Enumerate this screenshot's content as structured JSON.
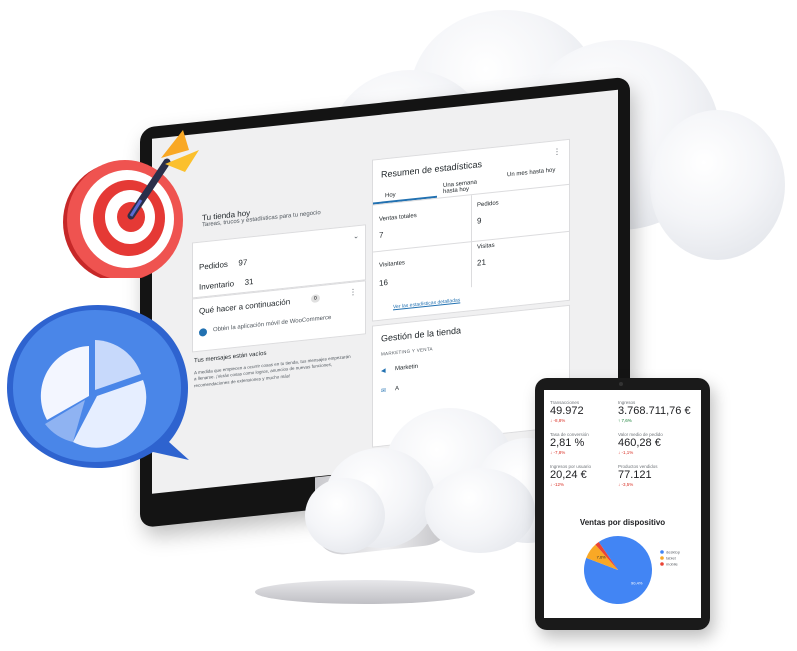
{
  "colors": {
    "wc_blue": "#2271b1",
    "target_red": "#e53935",
    "chat_blue": "#3b78e7",
    "pie_blue": "#4285f4",
    "pie_orange": "#f9a825",
    "pie_red": "#ea4335"
  },
  "store_today": {
    "title": "Tu tienda hoy",
    "subtitle": "Tareas, trucos y estadísticas para tu negocio",
    "orders_label": "Pedidos",
    "orders_value": "97",
    "inventory_label": "Inventario",
    "inventory_value": "31"
  },
  "next_steps": {
    "title": "Qué hacer a continuación",
    "badge": "0",
    "item": "Obtén la aplicación móvil de WooCommerce"
  },
  "messages": {
    "title": "Tus mensajes están vacíos",
    "body": "A medida que empiecen a ocurrir cosas en tu tienda, tus mensajes empezarán a llenarse. ¡Verás cosas como logros, anuncios de nuevas funciones, recomendaciones de extensiones y mucho más!"
  },
  "stats": {
    "title": "Resumen de estadísticas",
    "tabs": [
      "Hoy",
      "Una semana hasta hoy",
      "Un mes hasta hoy"
    ],
    "cells": [
      {
        "label": "Ventas totales",
        "value": "7"
      },
      {
        "label": "Pedidos",
        "value": "9"
      },
      {
        "label": "Visitantes",
        "value": "16"
      },
      {
        "label": "Visitas",
        "value": "21"
      }
    ],
    "link": "Ver las estadísticas detalladas"
  },
  "store_management": {
    "title": "Gestión de la tienda",
    "section": "MARKETING Y VENTA",
    "items": [
      "Marketin",
      "A"
    ]
  },
  "tablet": {
    "metrics": [
      {
        "label": "Transacciones",
        "value": "49.972",
        "delta": "-8,8%",
        "dir": "neg"
      },
      {
        "label": "Ingresos",
        "value": "3.768.711,76 €",
        "delta": "7,6%",
        "dir": "pos"
      },
      {
        "label": "Tasa de conversión",
        "value": "2,81 %",
        "delta": "-7,8%",
        "dir": "neg"
      },
      {
        "label": "Valor medio de pedido",
        "value": "460,28 €",
        "delta": "-1,1%",
        "dir": "neg"
      },
      {
        "label": "Ingresos por usuario",
        "value": "20,24 €",
        "delta": "-12%",
        "dir": "neg"
      },
      {
        "label": "Productos vendidos",
        "value": "77.121",
        "delta": "-3,5%",
        "dir": "neg"
      }
    ],
    "chart_title": "Ventas por dispositivo",
    "chart_data": {
      "type": "pie",
      "categories": [
        "desktop",
        "tablet",
        "mobile"
      ],
      "values": [
        90.4,
        7.6,
        2.0
      ],
      "title": "Ventas por dispositivo",
      "labels": [
        "90,4%",
        "7,6%",
        ""
      ],
      "legend": "right"
    }
  }
}
